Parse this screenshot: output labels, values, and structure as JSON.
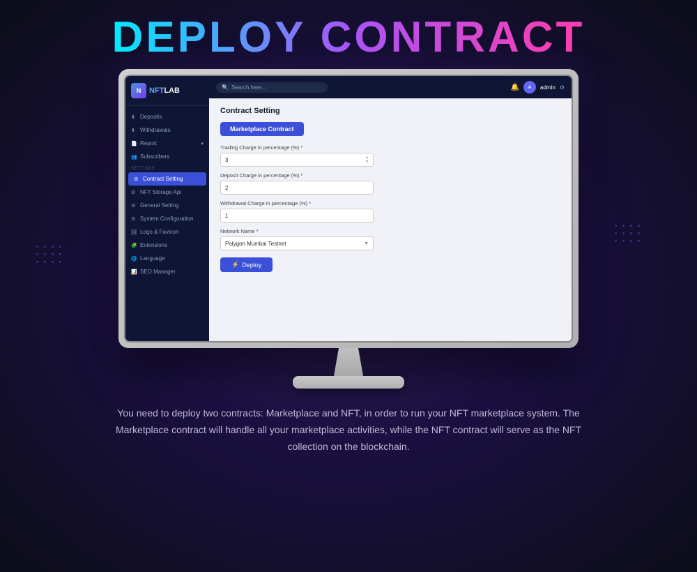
{
  "page": {
    "main_title": "DEPLOY CONTRACT",
    "bottom_text": "You need to deploy two contracts: Marketplace and NFT, in order to run your NFT marketplace system. The Marketplace contract will handle all your marketplace activities, while the NFT contract will serve as the NFT collection on the blockchain."
  },
  "topbar": {
    "search_placeholder": "Search here...",
    "admin_label": "admin",
    "bell_icon": "🔔",
    "settings_icon": "⚙"
  },
  "sidebar": {
    "logo_nft": "NFT",
    "logo_lab": "LAB",
    "items": [
      {
        "label": "Deposits",
        "icon": "⬇",
        "active": false
      },
      {
        "label": "Withdrawals",
        "icon": "⬆",
        "active": false
      },
      {
        "label": "Report",
        "icon": "📄",
        "active": false,
        "has_chevron": true
      },
      {
        "label": "Subscribers",
        "icon": "👥",
        "active": false
      }
    ],
    "settings_label": "SETTINGS",
    "settings_items": [
      {
        "label": "Contract Setting",
        "icon": "⚙",
        "active": true
      },
      {
        "label": "NFT Storage Api",
        "icon": "⚙",
        "active": false
      },
      {
        "label": "General Setting",
        "icon": "⚙",
        "active": false
      },
      {
        "label": "System Configuration",
        "icon": "⚙",
        "active": false
      },
      {
        "label": "Logo & Favicon",
        "icon": "🖼",
        "active": false
      },
      {
        "label": "Extensions",
        "icon": "🧩",
        "active": false
      },
      {
        "label": "Language",
        "icon": "🌐",
        "active": false
      },
      {
        "label": "SEO Manager",
        "icon": "📊",
        "active": false
      }
    ]
  },
  "content": {
    "page_title": "Contract Setting",
    "contract_tab_label": "Marketplace Contract",
    "form": {
      "trading_charge_label": "Trading Charge in percentage (%) *",
      "trading_charge_value": "3",
      "deposit_charge_label": "Deposit Charge in percentage (%) *",
      "deposit_charge_value": "2",
      "withdrawal_charge_label": "Withdrawal Charge in percentage (%) *",
      "withdrawal_charge_value": "1",
      "network_name_label": "Network Name *",
      "network_name_value": "Polygon Mumbai Testnet",
      "deploy_button_label": "Deploy",
      "deploy_icon": "🚀"
    }
  }
}
